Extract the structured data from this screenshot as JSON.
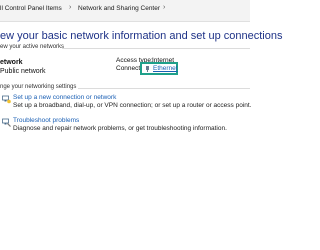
{
  "breadcrumb": {
    "items": [
      "ll Control Panel Items",
      "Network and Sharing Center"
    ],
    "separator": "›"
  },
  "header": {
    "title": "ew your basic network information and set up connections"
  },
  "active_networks": {
    "section_label": "ew your active networks",
    "network_name": "etwork",
    "network_type": "Public network",
    "access_type_label": "Access type:",
    "access_type_value": "Internet",
    "connections_label": "Connections:",
    "connection_value": "Ethernet"
  },
  "settings": {
    "section_label": "nge your networking settings",
    "tasks": [
      {
        "link": "Set up a new connection or network",
        "description": "Set up a broadband, dial-up, or VPN connection; or set up a router or access point.",
        "icon": "new-connection-icon"
      },
      {
        "link": "Troubleshoot problems",
        "description": "Diagnose and repair network problems, or get troubleshooting information.",
        "icon": "troubleshoot-icon"
      }
    ]
  },
  "colors": {
    "title": "#1e3287",
    "link": "#1a5fb4",
    "highlight_border": "#1fa08a"
  }
}
